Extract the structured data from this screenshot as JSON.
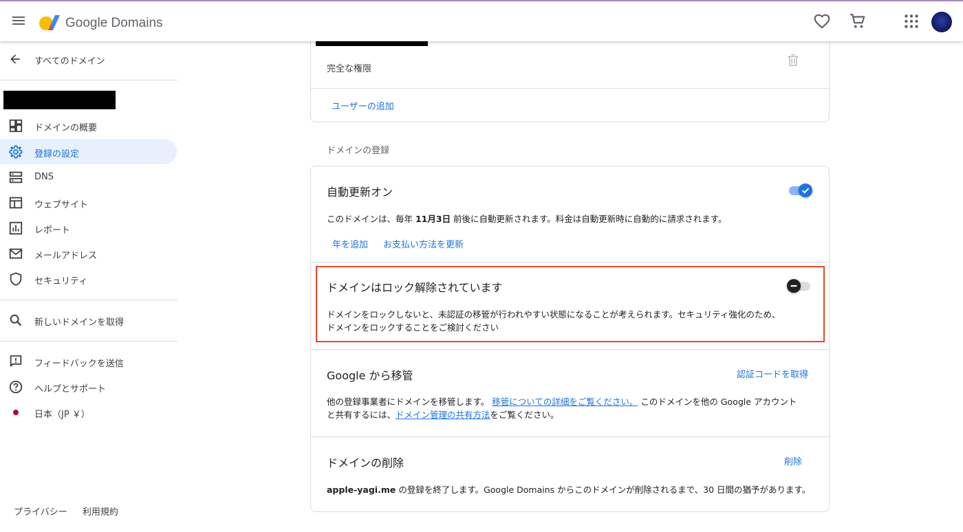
{
  "header": {
    "brand": "Google Domains",
    "icons": {
      "menu": "menu-icon",
      "favorites": "heart-icon",
      "cart": "cart-icon",
      "apps": "apps-grid-icon",
      "account": "avatar"
    }
  },
  "sidebar": {
    "back_label": "すべてのドメイン",
    "items": [
      {
        "label": "ドメインの概要",
        "icon": "dashboard-icon"
      },
      {
        "label": "登録の設定",
        "icon": "gear-icon",
        "active": true
      },
      {
        "label": "DNS",
        "icon": "dns-icon"
      },
      {
        "label": "ウェブサイト",
        "icon": "website-icon"
      },
      {
        "label": "レポート",
        "icon": "report-icon"
      },
      {
        "label": "メールアドレス",
        "icon": "mail-icon"
      },
      {
        "label": "セキュリティ",
        "icon": "shield-icon"
      }
    ],
    "search_label": "新しいドメインを取得",
    "support_items": [
      {
        "label": "フィードバックを送信",
        "icon": "feedback-icon"
      },
      {
        "label": "ヘルプとサポート",
        "icon": "help-icon"
      },
      {
        "label": "日本（JP ￥）",
        "icon": "japan-flag-icon"
      }
    ],
    "footer": {
      "privacy": "プライバシー",
      "terms": "利用規約"
    }
  },
  "users_card": {
    "permission": "完全な権限",
    "add_user": "ユーザーの追加"
  },
  "registration": {
    "section_title": "ドメインの登録",
    "auto_renew": {
      "title": "自動更新オン",
      "text_prefix": "このドメインは、毎年 ",
      "date": "11月3日",
      "text_suffix": " 前後に自動更新されます。料金は自動更新時に自動的に請求されます。",
      "add_year": "年を追加",
      "update_payment": "お支払い方法を更新",
      "enabled": true
    },
    "lock": {
      "title": "ドメインはロック解除されています",
      "text_line1": "ドメインをロックしないと、未認証の移管が行われやすい状態になることが考えられます。セキュリティ強化のため、",
      "text_line2": "ドメインをロックすることをご検討ください",
      "enabled": false
    },
    "transfer": {
      "title": "Google から移管",
      "action": "認証コードを取得",
      "text_part1": "他の登録事業者にドメインを移管します。",
      "link1": "移管についての詳細をご覧ください。",
      "text_part2": " このドメインを他の Google アカウント",
      "text_part3": "と共有するには、",
      "link2": "ドメイン管理の共有方法",
      "text_part4": "をご覧ください。"
    },
    "delete": {
      "title": "ドメインの削除",
      "action": "削除",
      "domain": "apple-yagi.me",
      "text": " の登録を終了します。Google Domains からこのドメインが削除されるまで、30 日間の猶予があります。"
    }
  },
  "colors": {
    "accent": "#1a73e8",
    "highlight_border": "#e8472a",
    "active_bg": "#e8f0fe",
    "divider": "#dadce0"
  }
}
